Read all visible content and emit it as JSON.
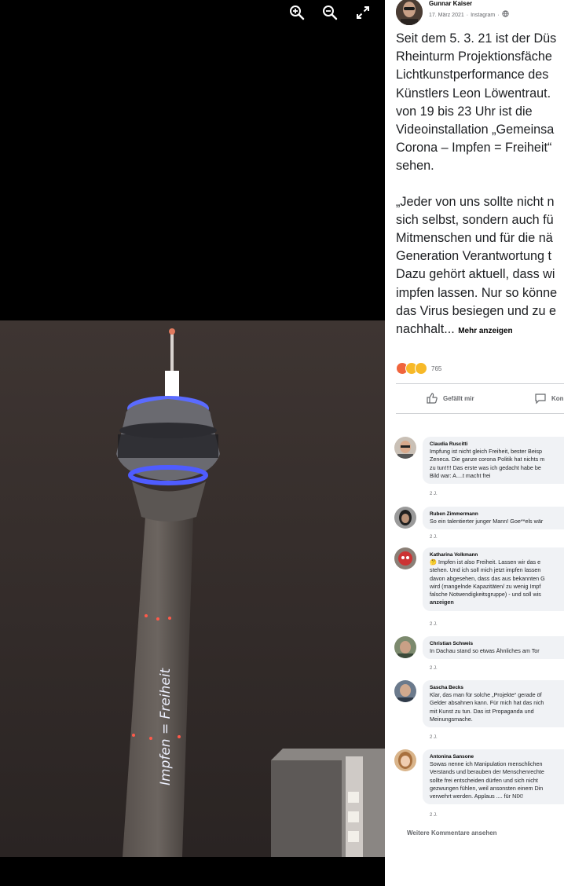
{
  "viewer": {
    "zoom_in_icon": "zoom-in-icon",
    "zoom_out_icon": "zoom-out-icon",
    "fullscreen_icon": "expand-icon",
    "projection_text": "Impfen = Freiheit"
  },
  "post": {
    "author": "Gunnar Kaiser",
    "date": "17. März 2021",
    "via": "Instagram",
    "separator": "·",
    "lines": [
      "Seit dem 5. 3. 21 ist der Düs",
      "Rheinturm Projektionsfäche",
      "Lichtkunstperformance des",
      "Künstlers Leon Löwentraut.",
      "von 19 bis 23 Uhr ist die",
      "Videoinstallation „Gemeinsa",
      "Corona – Impfen = Freiheit“",
      "sehen."
    ],
    "quote_lines": [
      "„Jeder von uns sollte nicht n",
      "sich selbst, sondern auch fü",
      "Mitmenschen und für die nä",
      "Generation Verantwortung t",
      "Dazu gehört aktuell, dass wi",
      "impfen lassen. Nur so könne",
      "das Virus besiegen und zu e"
    ],
    "last_line": "nachhalt...",
    "more_label": "Mehr anzeigen",
    "reaction_count": "765",
    "like_label": "Gefällt mir",
    "comment_label": "Kon"
  },
  "comments": [
    {
      "name": "Claudia Ruscitti",
      "lines": [
        "Impfung ist nicht gleich Freiheit, bester Beisp",
        "Zeneca. Die ganze corona Politik hat nichts m",
        "zu tun!!!! Das erste was ich gedacht habe be",
        "Bild war: A....t macht frei"
      ],
      "time": "2 J."
    },
    {
      "name": "Ruben Zimmermann",
      "lines": [
        "So ein talentierter junger Mann! Goe**els wär"
      ],
      "time": "2 J."
    },
    {
      "name": "Katharina Volkmann",
      "lines": [
        "Impfen ist also Freiheit. Lassen wir das e",
        "stehen. Und ich soll mich jetzt impfen lassen",
        "davon abgesehen, dass das aus bekannten G",
        "wird (mangelnde Kapazitäten/ zu wenig Impf",
        "falsche Notwendigkeitsgruppe) - und soll wis"
      ],
      "more": "anzeigen",
      "time": "2 J."
    },
    {
      "name": "Christian Schweis",
      "lines": [
        "In Dachau stand so etwas Ähnliches am Tor"
      ],
      "time": "2 J."
    },
    {
      "name": "Sascha Becks",
      "lines": [
        "Klar, das man für solche „Projekte“ gerade öf",
        "Gelder absahnen kann. Für mich hat das nich",
        "mit Kunst zu tun. Das ist Propaganda und",
        "Meinungsmache."
      ],
      "time": "2 J."
    },
    {
      "name": "Antonina Sansone",
      "lines": [
        "Sowas nenne ich Manipulation menschlichen",
        "Verstands und berauben der Menschenrechte",
        "sollte frei entscheiden dürfen und sich nicht",
        "gezwungen fühlen, weil ansonsten einem Din",
        "verwehrt werden. Applaus .... für NIX!"
      ],
      "time": "2 J."
    }
  ],
  "load_more_comments": "Weitere Kommentare ansehen"
}
